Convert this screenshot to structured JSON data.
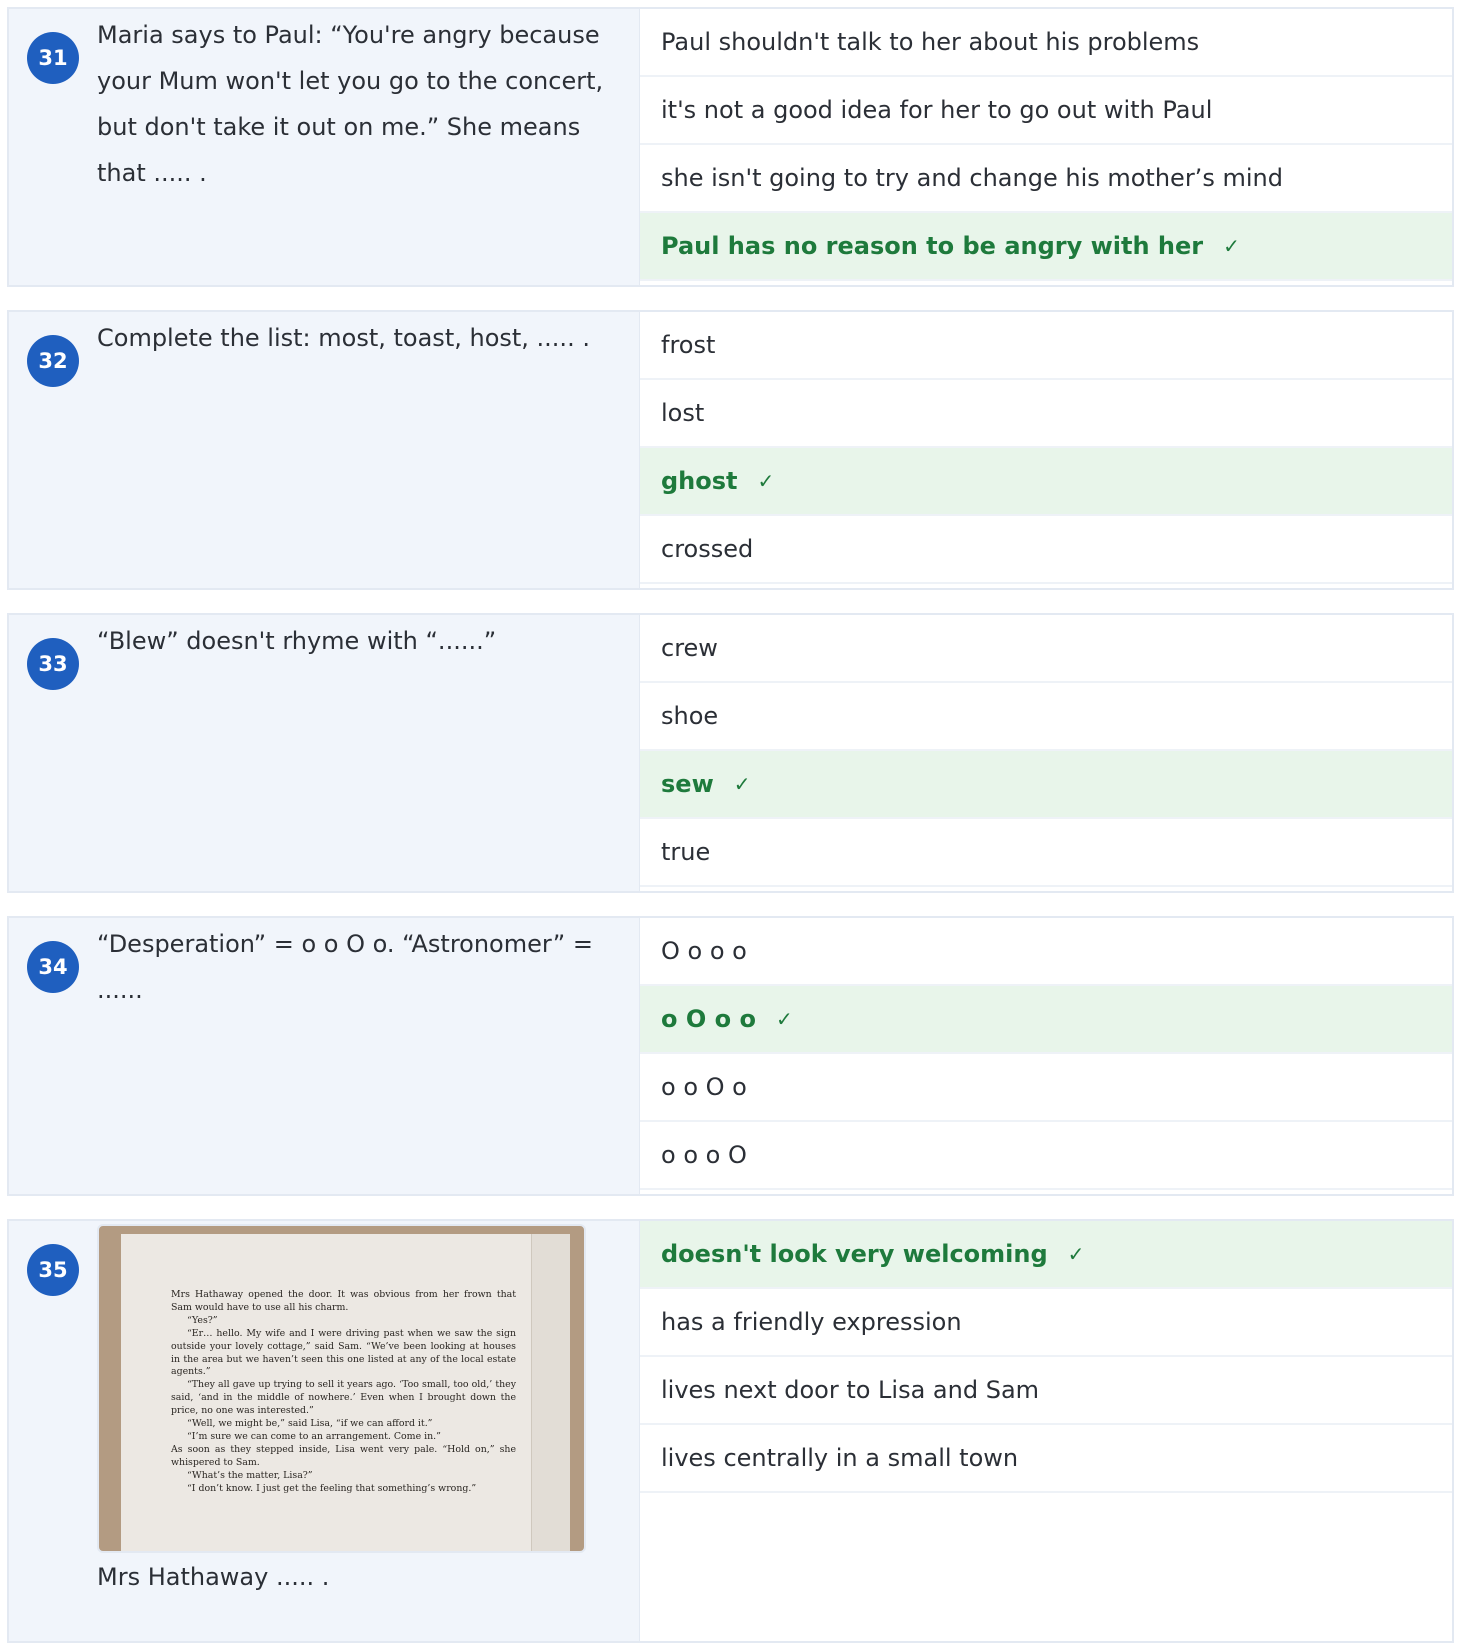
{
  "questions": [
    {
      "number": "31",
      "stem": "Maria says to Paul: “You're angry because your Mum won't let you go to the concert, but don't take it out on me.” She means that ..... .",
      "options": [
        {
          "text": "Paul shouldn't talk to her about his problems",
          "correct": false
        },
        {
          "text": "it's not a good idea for her to go out with Paul",
          "correct": false
        },
        {
          "text": "she isn't going to try and change his mother’s mind",
          "correct": false
        },
        {
          "text": "Paul has no reason to be angry with her",
          "correct": true
        }
      ]
    },
    {
      "number": "32",
      "stem": "Complete the list: most, toast, host, ..... .",
      "options": [
        {
          "text": "frost",
          "correct": false
        },
        {
          "text": "lost",
          "correct": false
        },
        {
          "text": "ghost",
          "correct": true
        },
        {
          "text": "crossed",
          "correct": false
        }
      ]
    },
    {
      "number": "33",
      "stem": "“Blew” doesn't rhyme with “......”",
      "options": [
        {
          "text": "crew",
          "correct": false
        },
        {
          "text": "shoe",
          "correct": false
        },
        {
          "text": "sew",
          "correct": true
        },
        {
          "text": "true",
          "correct": false
        }
      ]
    },
    {
      "number": "34",
      "stem": "“Desperation” = o o O o. “Astronomer” = ......",
      "options": [
        {
          "text": "O o o o",
          "correct": false
        },
        {
          "text": "o O o o",
          "correct": true
        },
        {
          "text": "o o O o",
          "correct": false
        },
        {
          "text": "o o o O",
          "correct": false
        }
      ]
    },
    {
      "number": "35",
      "stem": "Mrs Hathaway ..... .",
      "image_text": [
        "Mrs Hathaway opened the door. It was obvious from her frown that Sam would have to use all his charm.",
        "“Yes?”",
        "“Er… hello. My wife and I were driving past when we saw the sign outside your lovely cottage,” said Sam. “We’ve been looking at houses in the area but we haven’t seen this one listed at any of the local estate agents.”",
        "“They all gave up trying to sell it years ago. ‘Too small, too old,’ they said, ‘and in the middle of nowhere.’ Even when I brought down the price, no one was interested.”",
        "“Well, we might be,” said Lisa, “if we can afford it.”",
        "“I’m sure we can come to an arrangement. Come in.”",
        "As soon as they stepped inside, Lisa went very pale. “Hold on,” she whispered to Sam.",
        "“What’s the matter, Lisa?”",
        "“I don’t know. I just get the feeling that something’s wrong.”"
      ],
      "options": [
        {
          "text": "doesn't look very welcoming",
          "correct": true
        },
        {
          "text": "has a friendly expression",
          "correct": false
        },
        {
          "text": "lives next door to Lisa and Sam",
          "correct": false
        },
        {
          "text": "lives centrally in a small town",
          "correct": false
        }
      ]
    }
  ],
  "correct_mark": "✓",
  "colors": {
    "badge": "#1f5fbf",
    "correct_bg": "#e8f5ea",
    "correct_text": "#1e7a3c"
  }
}
